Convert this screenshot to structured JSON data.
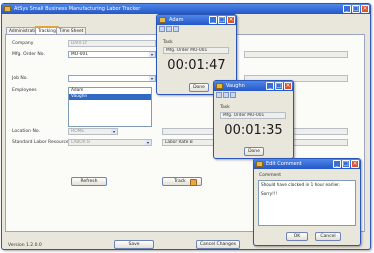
{
  "main": {
    "title": "AtSys Small Business Manufacturing Labor Tracker",
    "tabs": [
      "Administration",
      "Tracking",
      "Time Sheet"
    ],
    "company_label": "Company",
    "company_value": "DARFLY",
    "order_label": "Mfg. Order No.",
    "order_value": "MO-001",
    "job_label": "Job No.",
    "employees_label": "Employees",
    "employees": [
      "Adam",
      "Vaughn"
    ],
    "location_label": "Location No.",
    "location_value": "HOME",
    "standard_label": "Standard Labor Resource",
    "standard_value": "LABOR B",
    "labor_rate_label": "Labor Rate B",
    "refresh_label": "Refresh",
    "track_label": "Track",
    "version": "Version 1.2.0.0",
    "save_label": "Save",
    "cancel_changes_label": "Cancel Changes"
  },
  "adam": {
    "title": "Adam",
    "task_label": "Task",
    "task_value": "Mfg. Order MO-001",
    "time": "00:01:47",
    "done_label": "Done"
  },
  "vaughn": {
    "title": "Vaughn",
    "task_label": "Task",
    "task_value": "Mfg. Order MO-001",
    "time": "00:01:35",
    "done_label": "Done"
  },
  "comment": {
    "title": "Edit Comment",
    "label": "Comment",
    "line1": "Should have clocked in 1 hour earlier.",
    "line2": "Sorry!!!",
    "ok_label": "OK",
    "cancel_label": "Cancel"
  },
  "colors": {
    "titlebar": "#2458c8",
    "close": "#d9542f",
    "window_bg": "#e9e6dc"
  }
}
